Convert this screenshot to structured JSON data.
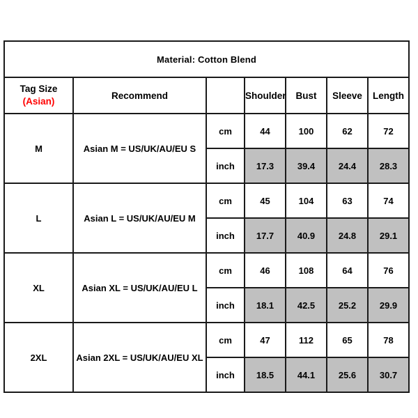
{
  "title": "Material: Cotton Blend",
  "header": {
    "tag_size_main": "Tag Size",
    "tag_size_asian": "(Asian)",
    "recommend": "Recommend",
    "unit_blank": "",
    "measurements": [
      "Shoulder",
      "Bust",
      "Sleeve",
      "Length"
    ]
  },
  "units": {
    "cm": "cm",
    "inch": "inch"
  },
  "colors": {
    "shaded_row_background": "#C0C0C0",
    "asian_label": "#FF0000",
    "border": "#1A1A1A",
    "page_background": "#FFFFFF"
  },
  "rows": [
    {
      "tag_size": "M",
      "recommend": "Asian M = US/UK/AU/EU S",
      "cm": {
        "shoulder": "44",
        "bust": "100",
        "sleeve": "62",
        "length": "72"
      },
      "inch": {
        "shoulder": "17.3",
        "bust": "39.4",
        "sleeve": "24.4",
        "length": "28.3"
      }
    },
    {
      "tag_size": "L",
      "recommend": "Asian L = US/UK/AU/EU M",
      "cm": {
        "shoulder": "45",
        "bust": "104",
        "sleeve": "63",
        "length": "74"
      },
      "inch": {
        "shoulder": "17.7",
        "bust": "40.9",
        "sleeve": "24.8",
        "length": "29.1"
      }
    },
    {
      "tag_size": "XL",
      "recommend": "Asian XL = US/UK/AU/EU L",
      "cm": {
        "shoulder": "46",
        "bust": "108",
        "sleeve": "64",
        "length": "76"
      },
      "inch": {
        "shoulder": "18.1",
        "bust": "42.5",
        "sleeve": "25.2",
        "length": "29.9"
      }
    },
    {
      "tag_size": "2XL",
      "recommend": "Asian 2XL = US/UK/AU/EU XL",
      "cm": {
        "shoulder": "47",
        "bust": "112",
        "sleeve": "65",
        "length": "78"
      },
      "inch": {
        "shoulder": "18.5",
        "bust": "44.1",
        "sleeve": "25.6",
        "length": "30.7"
      }
    }
  ]
}
